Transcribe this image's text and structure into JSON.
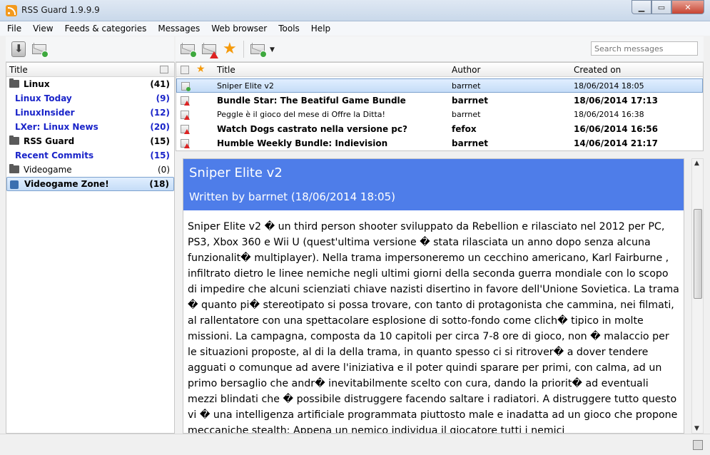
{
  "window": {
    "title": "RSS Guard 1.9.9.9"
  },
  "menubar": [
    "File",
    "View",
    "Feeds & categories",
    "Messages",
    "Web browser",
    "Tools",
    "Help"
  ],
  "toolbar": {
    "search_placeholder": "Search messages",
    "icons": [
      "update-feeds-icon",
      "mark-read-icon",
      "mark-unread-icon",
      "star-icon",
      "mark-read-dropdown-icon"
    ]
  },
  "feeds": {
    "header": "Title",
    "items": [
      {
        "name": "Linux",
        "count": "(41)",
        "type": "category",
        "bold": true,
        "blue": false
      },
      {
        "name": "Linux Today",
        "count": "(9)",
        "type": "feed",
        "bold": true,
        "blue": true
      },
      {
        "name": "LinuxInsider",
        "count": "(12)",
        "type": "feed",
        "bold": true,
        "blue": true
      },
      {
        "name": "LXer: Linux News",
        "count": "(20)",
        "type": "feed",
        "bold": true,
        "blue": true
      },
      {
        "name": "RSS Guard",
        "count": "(15)",
        "type": "category",
        "bold": true,
        "blue": false
      },
      {
        "name": "Recent Commits",
        "count": "(15)",
        "type": "feed",
        "bold": true,
        "blue": true
      },
      {
        "name": "Videogame",
        "count": "(0)",
        "type": "category",
        "bold": false,
        "blue": false
      },
      {
        "name": "Videogame Zone!",
        "count": "(18)",
        "type": "feed",
        "bold": true,
        "blue": false,
        "selected": true
      }
    ]
  },
  "messages": {
    "columns": {
      "title": "Title",
      "author": "Author",
      "created": "Created on"
    },
    "rows": [
      {
        "title": "Sniper Elite v2",
        "author": "barrnet",
        "date": "18/06/2014 18:05",
        "bold": false,
        "selected": true,
        "status": "ok"
      },
      {
        "title": "Bundle Star: The Beatiful Game Bundle",
        "author": "barrnet",
        "date": "18/06/2014 17:13",
        "bold": true,
        "status": "err"
      },
      {
        "title": "Peggle è il gioco del mese di Offre la Ditta!",
        "author": "barrnet",
        "date": "18/06/2014 16:38",
        "bold": false,
        "status": "err"
      },
      {
        "title": "Watch Dogs castrato nella versione pc?",
        "author": "fefox",
        "date": "16/06/2014 16:56",
        "bold": true,
        "status": "err"
      },
      {
        "title": "Humble Weekly Bundle: Indievision",
        "author": "barrnet",
        "date": "14/06/2014 21:17",
        "bold": true,
        "status": "err"
      }
    ]
  },
  "preview": {
    "title": "Sniper Elite v2",
    "byline": "Written by barrnet (18/06/2014 18:05)",
    "body": "Sniper Elite v2 � un third person shooter sviluppato da Rebellion e rilasciato nel 2012 per PC, PS3, Xbox 360 e Wii U (quest'ultima versione � stata rilasciata un anno dopo senza alcuna funzionalit� multiplayer). Nella trama impersoneremo un cecchino americano, Karl Fairburne , infiltrato dietro le linee nemiche negli ultimi giorni della seconda guerra mondiale con lo scopo di impedire che alcuni scienziati chiave nazisti disertino in favore dell'Unione Sovietica. La trama � quanto pi� stereotipato si possa trovare, con tanto di protagonista che cammina, nei filmati, al rallentatore con una spettacolare esplosione di sotto-fondo come clich� tipico in molte missioni. La campagna, composta da 10 capitoli per circa 7-8 ore di gioco, non � malaccio per le situazioni proposte, al di la della trama, in quanto spesso ci si ritrover� a dover tendere agguati o comunque ad avere l'iniziativa e il poter quindi sparare per primi, con calma, ad un primo bersaglio che andr� inevitabilmente scelto con cura, dando la priorit� ad eventuali mezzi blindati che � possibile distruggere facendo saltare i radiatori. A distruggere tutto questo vi � una intelligenza artificiale programmata piuttosto male e inadatta ad un gioco che propone meccaniche stealth: Appena un nemico individua il giocatore tutti i nemici"
  },
  "colors": {
    "preview_header": "#4e7de9",
    "link_blue": "#1a24c9"
  }
}
